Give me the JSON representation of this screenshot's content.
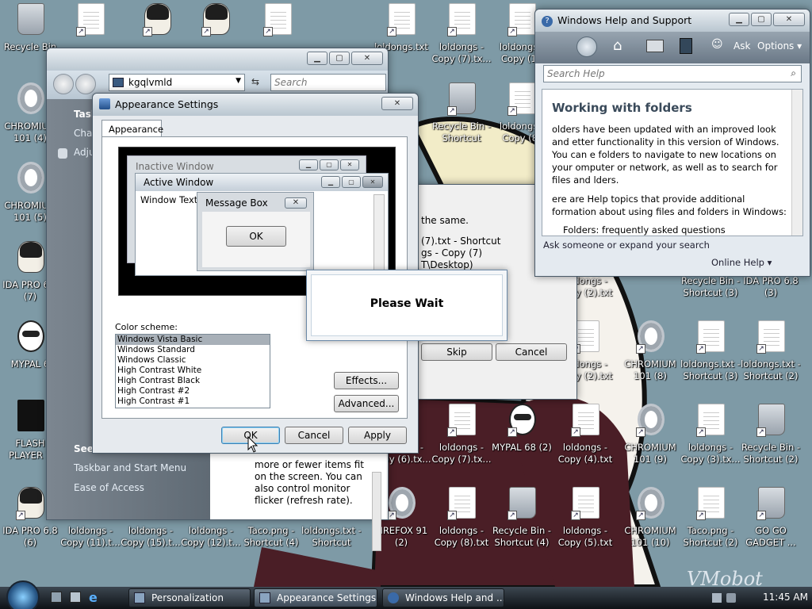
{
  "desktop": {
    "icons": [
      {
        "label": "Recycle Bin",
        "type": "bin"
      },
      {
        "label": "CHROMIUM 101 (4)",
        "type": "chrome"
      },
      {
        "label": "CHROMIUM 101 (5)",
        "type": "chrome"
      },
      {
        "label": "IDA PRO 6.8 (7)",
        "type": "face"
      },
      {
        "label": "MYPAL 6",
        "type": "raccoon"
      },
      {
        "label": "FLASH PLAYER 1",
        "type": "flash"
      },
      {
        "label": "IDA PRO 6.8 (6)",
        "type": "face"
      },
      {
        "label": "loldongs - Copy (11).t...",
        "type": "doc"
      },
      {
        "label": "loldongs - Copy (15).t...",
        "type": "doc"
      },
      {
        "label": "loldongs - Copy (12).t...",
        "type": "doc"
      },
      {
        "label": "Taco.png - Shortcut (4)",
        "type": "doc"
      },
      {
        "label": "loldongs.txt - Shortcut",
        "type": "doc"
      },
      {
        "label": "FIREFOX 91 (2)",
        "type": "chrome"
      },
      {
        "label": "loldongs - Copy (8).txt",
        "type": "doc"
      },
      {
        "label": "Recycle Bin - Shortcut (4)",
        "type": "bin"
      },
      {
        "label": "loldongs - Copy (5).txt",
        "type": "doc"
      },
      {
        "label": "CHROMIUM 101 (10)",
        "type": "chrome"
      },
      {
        "label": "Taco.png - Shortcut (2)",
        "type": "doc"
      },
      {
        "label": "GO GO GADGET ...",
        "type": "bin"
      },
      {
        "label": "loldongs - Copy (6).tx...",
        "type": "doc"
      },
      {
        "label": "loldongs - Copy (7).tx...",
        "type": "doc"
      },
      {
        "label": "MYPAL 68 (2)",
        "type": "raccoon"
      },
      {
        "label": "loldongs - Copy (4).txt",
        "type": "doc"
      },
      {
        "label": "CHROMIUM 101 (9)",
        "type": "chrome"
      },
      {
        "label": "loldongs - Copy (3).tx...",
        "type": "doc"
      },
      {
        "label": "Recycle Bin - Shortcut (2)",
        "type": "bin"
      },
      {
        "label": "loldongs - Copy (2).txt",
        "type": "doc"
      },
      {
        "label": "CHROMIUM 101 (8)",
        "type": "chrome"
      },
      {
        "label": "loldongs.txt - Shortcut (3)",
        "type": "doc"
      },
      {
        "label": "loldongs.txt - Shortcut (2)",
        "type": "doc"
      },
      {
        "label": "loldongs - Copy (2).txt",
        "type": "doc"
      },
      {
        "label": "Recycle Bin - Shortcut (3)",
        "type": "bin"
      },
      {
        "label": "IDA PRO 6.8 (3)",
        "type": "face"
      },
      {
        "label": "Recycle Bin - Shortcut",
        "type": "bin"
      },
      {
        "label": "loldongs - Copy (8)",
        "type": "doc"
      },
      {
        "label": "loldongs - Copy (7).tx...",
        "type": "doc"
      },
      {
        "label": "loldongs - Copy (15",
        "type": "doc"
      },
      {
        "label": "loldongs.txt",
        "type": "doc"
      },
      {
        "label": "",
        "type": "doc"
      },
      {
        "label": "",
        "type": "face"
      },
      {
        "label": "",
        "type": "face"
      },
      {
        "label": "",
        "type": "doc"
      }
    ]
  },
  "personalization": {
    "address": "kgqlvmld",
    "search_placeholder": "Search",
    "left_items": [
      "Task",
      "Chan",
      "Adju"
    ],
    "see_also": "See",
    "links": [
      "Taskbar and Start Menu",
      "Ease of Access"
    ],
    "body_lines": [
      "more or fewer items fit",
      "on the screen. You can",
      "also control monitor",
      "flicker (refresh rate)."
    ],
    "body_partial": "..."
  },
  "appearance": {
    "title": "Appearance Settings",
    "tab": "Appearance",
    "preview": {
      "inactive_title": "Inactive Window",
      "active_title": "Active Window",
      "window_text": "Window Text",
      "message_title": "Message Box",
      "message_ok": "OK"
    },
    "color_scheme_label": "Color scheme:",
    "schemes": [
      "Windows Vista Basic",
      "Windows Standard",
      "Windows Classic",
      "High Contrast White",
      "High Contrast Black",
      "High Contrast #2",
      "High Contrast #1"
    ],
    "selected_scheme": "Windows Vista Basic",
    "effects": "Effects...",
    "advanced": "Advanced...",
    "ok": "OK",
    "cancel": "Cancel",
    "apply": "Apply"
  },
  "copy_dialog": {
    "text_same": "the same.",
    "line1": "(7).txt - Shortcut",
    "line2": "gs - Copy (7)",
    "line3": "T\\Desktop)",
    "skip": "Skip",
    "cancel": "Cancel"
  },
  "please_wait": {
    "text": "Please Wait"
  },
  "help": {
    "title": "Windows Help and Support",
    "ask": "Ask",
    "options": "Options",
    "search_placeholder": "Search Help",
    "heading": "Working with folders",
    "para1": "olders have been updated with an improved look and etter functionality in this version of Windows. You can e folders to navigate to new locations on your omputer or network, as well as to search for files and lders.",
    "para2": "ere are Help topics that provide additional formation about using files and folders in Windows:",
    "bullet": "Folders: frequently asked questions",
    "ask_bar": "Ask someone or expand your search",
    "online": "Online Help"
  },
  "taskbar": {
    "tasks": [
      "Personalization",
      "Appearance Settings",
      "Windows Help and ..."
    ],
    "clock": "11:45 AM",
    "watermark": "VMobot"
  },
  "colors": {
    "wallpaper": "#7e9aa6",
    "maroon": "#4a1e26",
    "accent": "#0b55c4"
  }
}
